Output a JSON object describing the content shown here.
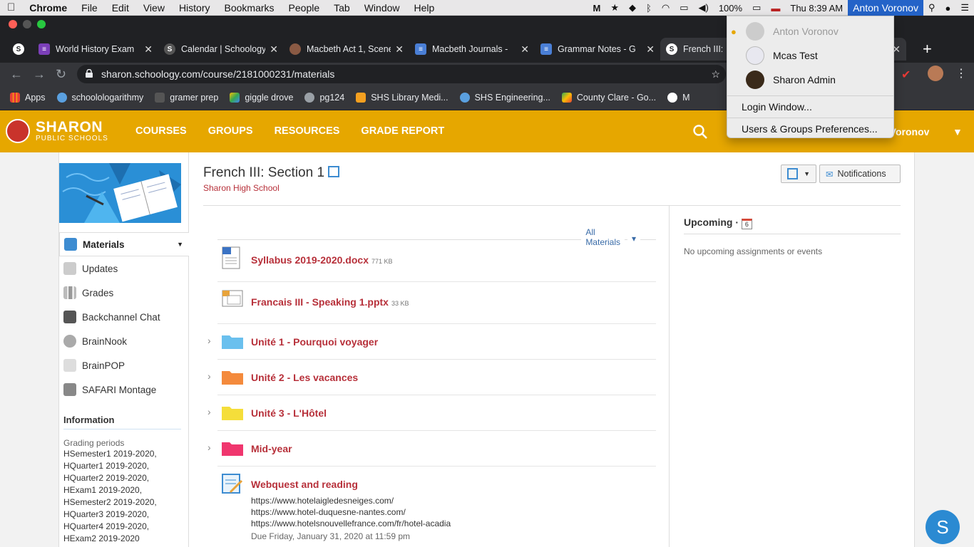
{
  "menubar": {
    "app": "Chrome",
    "items": [
      "File",
      "Edit",
      "View",
      "History",
      "Bookmarks",
      "People",
      "Tab",
      "Window",
      "Help"
    ],
    "battery": "100%",
    "clock": "Thu 8:39 AM",
    "user": "Anton Voronov"
  },
  "tabs": [
    {
      "title": "World History Exam",
      "icon": "onenote-icon"
    },
    {
      "title": "Calendar | Schoology",
      "icon": "schoology-icon"
    },
    {
      "title": "Macbeth Act 1, Scene",
      "icon": "macbeth-icon"
    },
    {
      "title": "Macbeth Journals -",
      "icon": "docs-icon"
    },
    {
      "title": "Grammar Notes - G",
      "icon": "docs-icon"
    },
    {
      "title": "French III:",
      "icon": "schoology-icon"
    }
  ],
  "address": "sharon.schoology.com/course/2181000231/materials",
  "bookmarks": [
    {
      "label": "Apps",
      "color": "#e94235"
    },
    {
      "label": "schoolologarithmy",
      "color": "#5aa0e0"
    },
    {
      "label": "gramer prep",
      "color": "#555555"
    },
    {
      "label": "giggle drove",
      "color": "#34a853"
    },
    {
      "label": "pg124",
      "color": "#9aa0a6"
    },
    {
      "label": "SHS Library Medi...",
      "color": "#f4a020"
    },
    {
      "label": "SHS Engineering...",
      "color": "#5aa0e0"
    },
    {
      "label": "County Clare - Go...",
      "color": "#34a853"
    },
    {
      "label": "M",
      "color": "#ffffff"
    }
  ],
  "header": {
    "logo_main": "SHARON",
    "logo_sub": "PUBLIC SCHOOLS",
    "nav": [
      "COURSES",
      "GROUPS",
      "RESOURCES",
      "GRADE REPORT"
    ],
    "user_partial": "e Voronov"
  },
  "sidebar": {
    "items": [
      {
        "label": "Materials"
      },
      {
        "label": "Updates"
      },
      {
        "label": "Grades"
      },
      {
        "label": "Backchannel Chat"
      },
      {
        "label": "BrainNook"
      },
      {
        "label": "BrainPOP"
      },
      {
        "label": "SAFARI Montage"
      }
    ],
    "info_title": "Information",
    "grading_label": "Grading periods",
    "grading_periods": [
      "HSemester1 2019-2020,",
      "HQuarter1 2019-2020,",
      "HQuarter2 2019-2020,",
      "HExam1 2019-2020,",
      "HSemester2 2019-2020,",
      "HQuarter3 2019-2020,",
      "HQuarter4 2019-2020,",
      "HExam2 2019-2020"
    ]
  },
  "course": {
    "title": "French III: Section 1",
    "school": "Sharon High School",
    "notifications": "Notifications"
  },
  "materials": {
    "filter": "All Materials",
    "items": [
      {
        "name": "Syllabus 2019-2020.docx",
        "size": "771 KB"
      },
      {
        "name": "Francais III - Speaking 1.pptx",
        "size": "33 KB"
      },
      {
        "name": "Unité 1 - Pourquoi voyager"
      },
      {
        "name": "Unité 2 - Les vacances"
      },
      {
        "name": "Unité 3 - L'Hôtel"
      },
      {
        "name": "Mid-year"
      },
      {
        "name": "Webquest and reading",
        "urls": [
          "https://www.hotelaigledesneiges.com/",
          "https://www.hotel-duquesne-nantes.com/",
          "https://www.hotelsnouvellefrance.com/fr/hotel-acadia"
        ],
        "due": "Due Friday, January 31, 2020 at 11:59 pm"
      }
    ]
  },
  "upcoming": {
    "title": "Upcoming",
    "calendar_day": "6",
    "empty": "No upcoming assignments or events"
  },
  "user_menu": {
    "accounts": [
      "Anton Voronov",
      "Mcas Test",
      "Sharon Admin"
    ],
    "login_window": "Login Window...",
    "prefs": "Users & Groups Preferences..."
  },
  "fab": "S"
}
